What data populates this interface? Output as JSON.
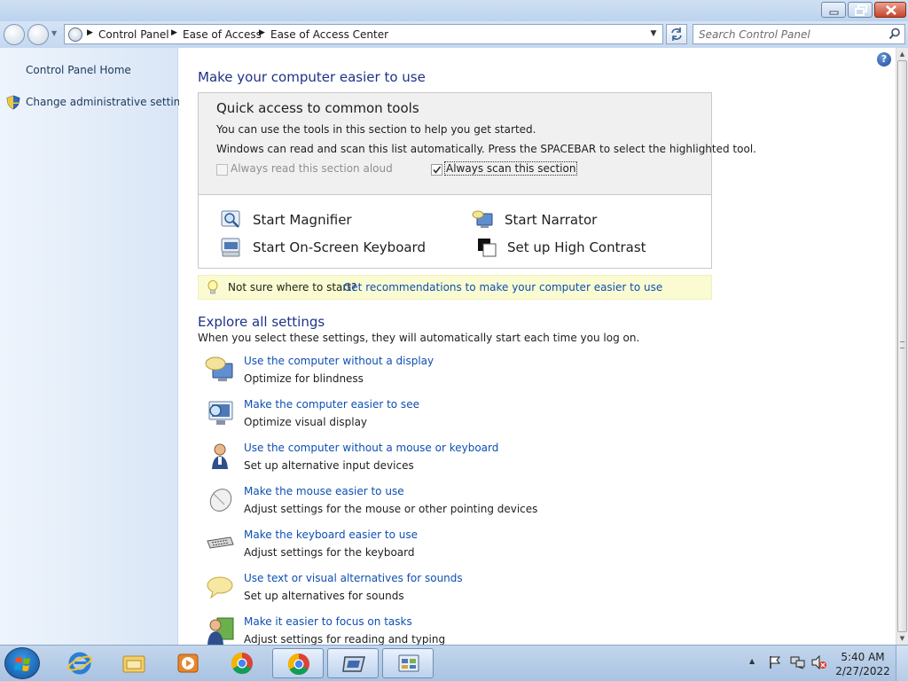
{
  "address": {
    "crumbs": [
      "Control Panel",
      "Ease of Access",
      "Ease of Access Center"
    ]
  },
  "search": {
    "placeholder": "Search Control Panel"
  },
  "left_pane": {
    "home_link": "Control Panel Home",
    "admin_link": "Change administrative settings"
  },
  "main": {
    "title": "Make your computer easier to use",
    "quick_access": {
      "title": "Quick access to common tools",
      "line1": "You can use the tools in this section to help you get started.",
      "line2": "Windows can read and scan this list automatically.  Press the SPACEBAR to select the highlighted tool.",
      "read_aloud": {
        "label": "Always read this section aloud",
        "checked": false,
        "enabled": false
      },
      "scan": {
        "label": "Always scan this section",
        "checked": true,
        "enabled": true
      },
      "tools": [
        {
          "label": "Start Magnifier",
          "icon": "magnifier-icon"
        },
        {
          "label": "Start Narrator",
          "icon": "narrator-icon"
        },
        {
          "label": "Start On-Screen Keyboard",
          "icon": "on-screen-keyboard-icon"
        },
        {
          "label": "Set up High Contrast",
          "icon": "high-contrast-icon"
        }
      ]
    },
    "tip": {
      "text": "Not sure where to start?",
      "link": "Get recommendations to make your computer easier to use"
    },
    "explore": {
      "title": "Explore all settings",
      "description": "When you select these settings, they will automatically start each time you log on.",
      "items": [
        {
          "link": "Use the computer without a display",
          "desc": "Optimize for blindness",
          "icon": "speech-monitor-icon"
        },
        {
          "link": "Make the computer easier to see",
          "desc": "Optimize visual display",
          "icon": "magnify-monitor-icon"
        },
        {
          "link": "Use the computer without a mouse or keyboard",
          "desc": "Set up alternative input devices",
          "icon": "person-icon"
        },
        {
          "link": "Make the mouse easier to use",
          "desc": "Adjust settings for the mouse or other pointing devices",
          "icon": "mouse-icon"
        },
        {
          "link": "Make the keyboard easier to use",
          "desc": "Adjust settings for the keyboard",
          "icon": "keyboard-icon"
        },
        {
          "link": "Use text or visual alternatives for sounds",
          "desc": "Set up alternatives for sounds",
          "icon": "speech-bubble-icon"
        },
        {
          "link": "Make it easier to focus on tasks",
          "desc": "Adjust settings for reading and typing",
          "icon": "focus-person-icon"
        }
      ]
    }
  },
  "taskbar": {
    "items": [
      "internet-explorer-icon",
      "file-explorer-icon",
      "media-player-icon",
      "chrome-icon",
      "chrome-icon",
      "display-icon",
      "control-panel-icon"
    ],
    "time": "5:40 AM",
    "date": "2/27/2022"
  }
}
